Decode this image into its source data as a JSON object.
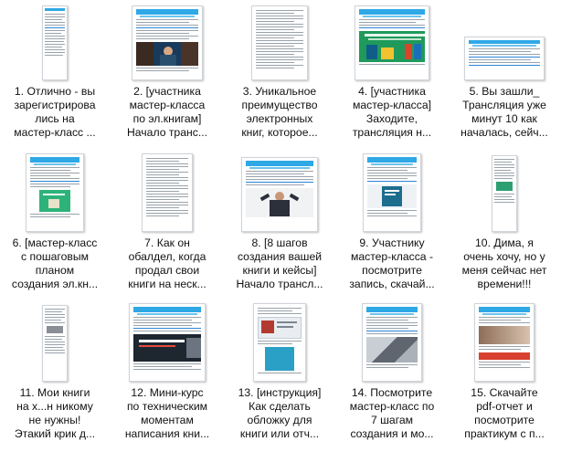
{
  "files": [
    {
      "label": "1. Отлично - вы зарегистрировались на мастер-класс ...",
      "lines": [
        "1. Отлично - вы",
        "зарегистрирова",
        "лись на",
        "мастер-класс ..."
      ],
      "thumb": "tall"
    },
    {
      "label": "2. [участника мастер-класса по эл.книгам] Начало транс...",
      "lines": [
        "2. [участника",
        "мастер-класса",
        "по эл.книгам]",
        "Начало транс..."
      ],
      "thumb": "email-photo"
    },
    {
      "label": "3. Уникальное преимущество электронных книг, которое...",
      "lines": [
        "3. Уникальное",
        "преимущество",
        "электронных",
        "книг, которое..."
      ],
      "thumb": "text"
    },
    {
      "label": "4. [участника мастер-класса] Заходите, трансляция н...",
      "lines": [
        "4. [участника",
        "мастер-класса]",
        "Заходите,",
        "трансляция н..."
      ],
      "thumb": "email-green"
    },
    {
      "label": "5. Вы зашли_ Трансляция уже минут 10 как началась, сейч...",
      "lines": [
        "5. Вы зашли_",
        "Трансляция уже",
        "минут 10 как",
        "началась, сейч..."
      ],
      "thumb": "short"
    },
    {
      "label": "6. [мастер-класс с пошаговым планом создания эл.кн...",
      "lines": [
        "6. [мастер-класс",
        "с пошаговым",
        "планом",
        "создания эл.кн..."
      ],
      "thumb": "email-book"
    },
    {
      "label": "7. Как он обалдел, когда продал свои книги на неск...",
      "lines": [
        "7. Как он",
        "обалдел, когда",
        "продал свои",
        "книги на неск..."
      ],
      "thumb": "text2"
    },
    {
      "label": "8. [8 шагов создания вашей книги и кейсы] Начало трансл...",
      "lines": [
        "8. [8 шагов",
        "создания вашей",
        "книги и кейсы]",
        "Начало трансл..."
      ],
      "thumb": "email-man"
    },
    {
      "label": "9. Участнику мастер-класса - посмотрите запись, скачай...",
      "lines": [
        "9. Участнику",
        "мастер-класса -",
        "посмотрите",
        "запись, скачай..."
      ],
      "thumb": "email-cover"
    },
    {
      "label": "10. Дима, я очень хочу, но у меня сейчас нет времени!!!",
      "lines": [
        "10. Дима, я",
        "очень хочу, но у",
        "меня сейчас нет",
        "времени!!!"
      ],
      "thumb": "tall2"
    },
    {
      "label": "11. Мои книги на х...н никому не нужны! Этакий крик д...",
      "lines": [
        "11. Мои книги",
        "на х...н никому",
        "не нужны!",
        "Этакий крик д..."
      ],
      "thumb": "tall3"
    },
    {
      "label": "12. Мини-курс по техническим моментам написания кни...",
      "lines": [
        "12. Мини-курс",
        "по техническим",
        "моментам",
        "написания кни..."
      ],
      "thumb": "email-dark"
    },
    {
      "label": "13. [инструкция] Как сделать обложку для книги или отч...",
      "lines": [
        "13. [инструкция]",
        "Как сделать",
        "обложку для",
        "книги или отч..."
      ],
      "thumb": "email-shots"
    },
    {
      "label": "14. Посмотрите мастер-класс по 7 шагам создания и мо...",
      "lines": [
        "14. Посмотрите",
        "мастер-класс по",
        "7 шагам",
        "создания и мо..."
      ],
      "thumb": "email-gray"
    },
    {
      "label": "15. Скачайте pdf-отчет и посмотрите практикум с п...",
      "lines": [
        "15. Скачайте",
        "pdf-отчет и",
        "посмотрите",
        "практикум с п..."
      ],
      "thumb": "email-red"
    }
  ],
  "colors": {
    "header_blue": "#2fa8e6",
    "link_blue": "#2a86d6",
    "green": "#1f9a5b"
  }
}
